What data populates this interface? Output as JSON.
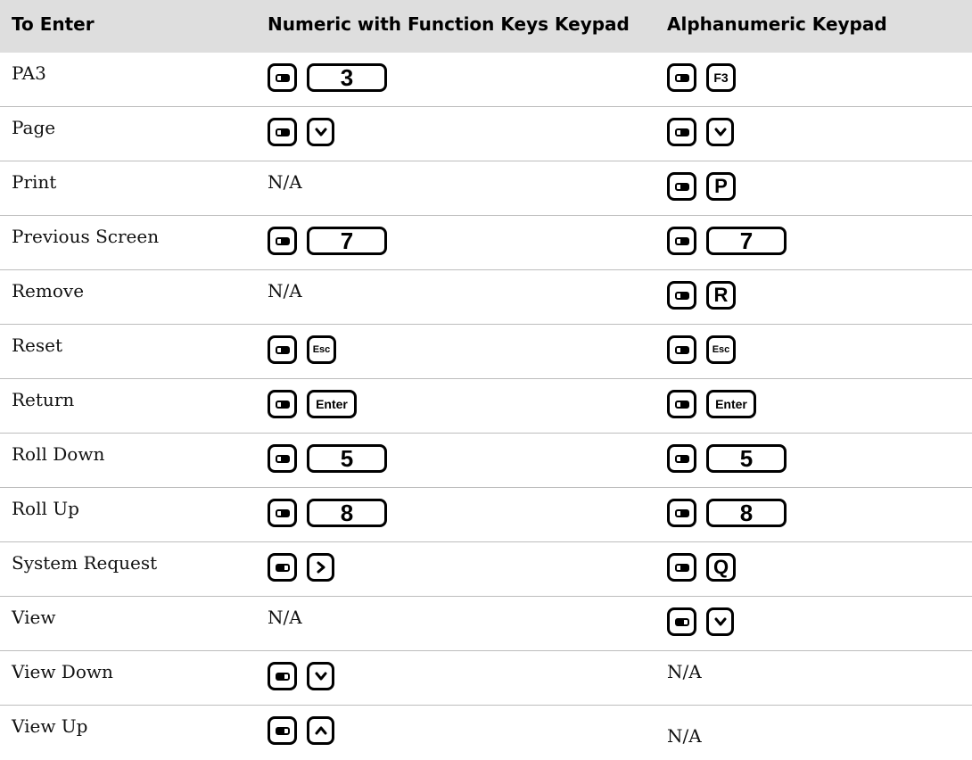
{
  "headers": [
    "To Enter",
    "Numeric with Function Keys Keypad",
    "Alphanumeric Keypad"
  ],
  "na_text": "N/A",
  "rows": [
    {
      "label": "PA3",
      "numeric": [
        "orange-shift",
        "3"
      ],
      "alpha": [
        "orange-shift",
        "F3"
      ]
    },
    {
      "label": "Page",
      "numeric": [
        "orange-shift",
        "down-arrow"
      ],
      "alpha": [
        "orange-shift",
        "down-arrow"
      ]
    },
    {
      "label": "Print",
      "numeric": "N/A",
      "alpha": [
        "orange-shift",
        "P"
      ]
    },
    {
      "label": "Previous Screen",
      "numeric": [
        "orange-shift",
        "7"
      ],
      "alpha": [
        "orange-shift",
        "7"
      ]
    },
    {
      "label": "Remove",
      "numeric": "N/A",
      "alpha": [
        "orange-shift",
        "R"
      ]
    },
    {
      "label": "Reset",
      "numeric": [
        "orange-shift",
        "Esc"
      ],
      "alpha": [
        "orange-shift",
        "Esc"
      ]
    },
    {
      "label": "Return",
      "numeric": [
        "orange-shift",
        "Enter"
      ],
      "alpha": [
        "orange-shift",
        "Enter"
      ]
    },
    {
      "label": "Roll Down",
      "numeric": [
        "orange-shift",
        "5"
      ],
      "alpha": [
        "orange-shift",
        "5"
      ]
    },
    {
      "label": "Roll Up",
      "numeric": [
        "orange-shift",
        "8"
      ],
      "alpha": [
        "orange-shift",
        "8"
      ]
    },
    {
      "label": "System Request",
      "numeric": [
        "green-shift",
        "right-arrow"
      ],
      "alpha": [
        "orange-shift",
        "Q"
      ]
    },
    {
      "label": "View",
      "numeric": "N/A",
      "alpha": [
        "green-shift",
        "down-arrow"
      ]
    },
    {
      "label": "View Down",
      "numeric": [
        "green-shift",
        "down-arrow"
      ],
      "alpha": "N/A"
    },
    {
      "label": "View Up",
      "numeric": [
        "green-shift",
        "up-arrow"
      ],
      "alpha": "N/A"
    }
  ]
}
